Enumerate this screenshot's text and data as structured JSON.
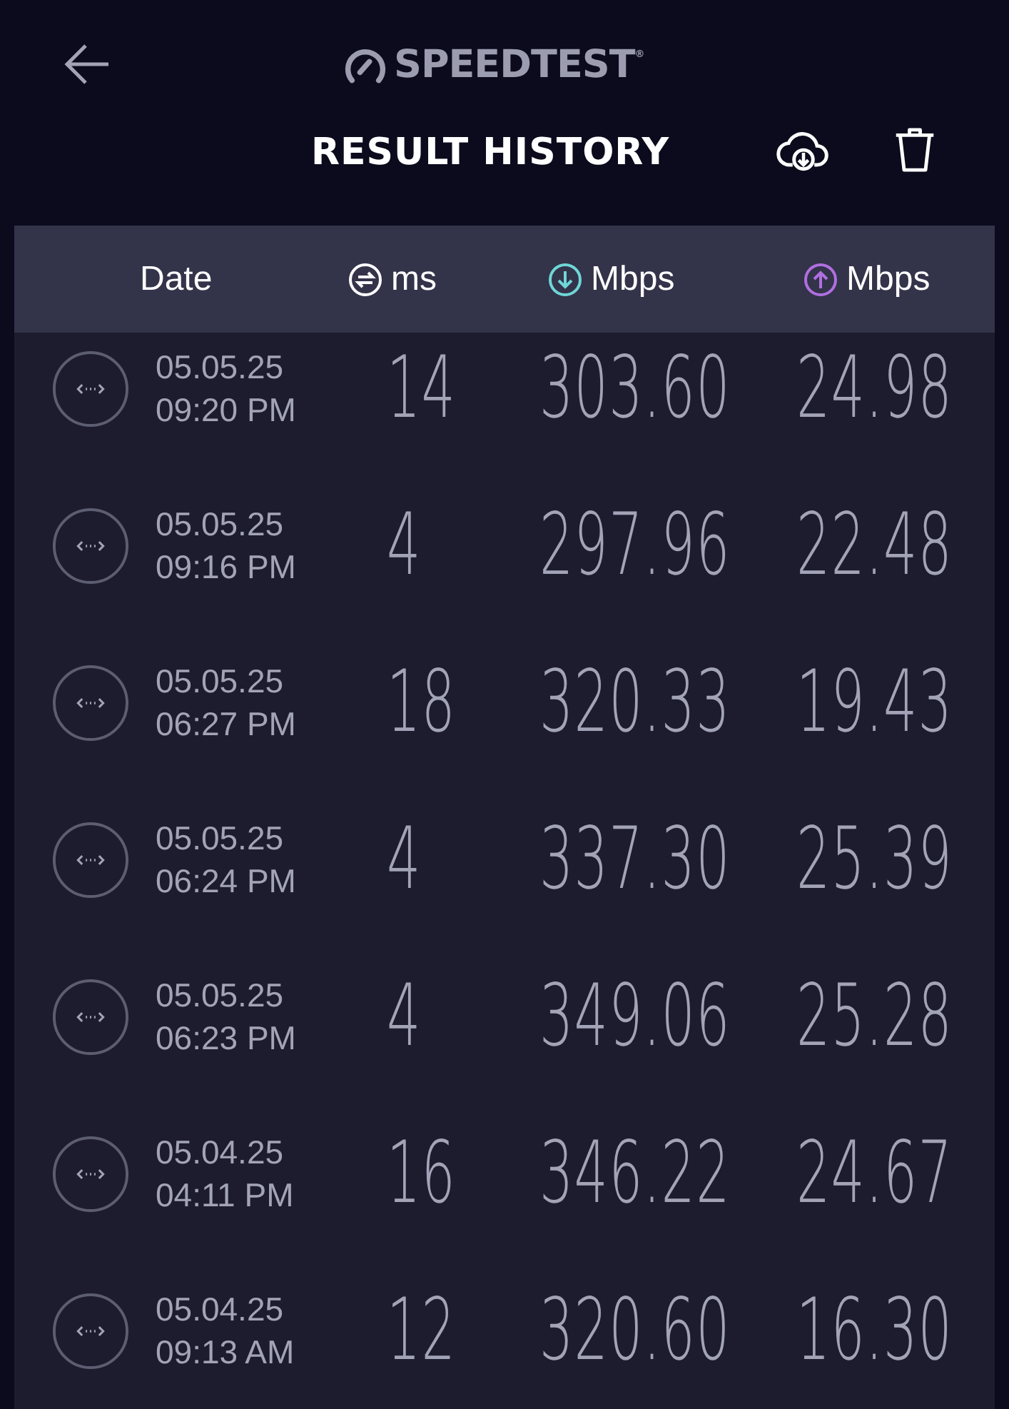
{
  "logo": {
    "text": "SPEEDTEST",
    "mark": "®"
  },
  "title": "RESULT HISTORY",
  "columns": [
    {
      "label": "Date",
      "kind": "date"
    },
    {
      "label": "ms",
      "kind": "ping"
    },
    {
      "label": "Mbps",
      "kind": "download"
    },
    {
      "label": "Mbps",
      "kind": "upload"
    }
  ],
  "rows": [
    {
      "date": "05.05.25",
      "time": "09:20 PM",
      "ping": "14",
      "download": "303.60",
      "upload": "24.98"
    },
    {
      "date": "05.05.25",
      "time": "09:16 PM",
      "ping": "4",
      "download": "297.96",
      "upload": "22.48"
    },
    {
      "date": "05.05.25",
      "time": "06:27 PM",
      "ping": "18",
      "download": "320.33",
      "upload": "19.43"
    },
    {
      "date": "05.05.25",
      "time": "06:24 PM",
      "ping": "4",
      "download": "337.30",
      "upload": "25.39"
    },
    {
      "date": "05.05.25",
      "time": "06:23 PM",
      "ping": "4",
      "download": "349.06",
      "upload": "25.28"
    },
    {
      "date": "05.04.25",
      "time": "04:11 PM",
      "ping": "16",
      "download": "346.22",
      "upload": "24.67"
    },
    {
      "date": "05.04.25",
      "time": "09:13 AM",
      "ping": "12",
      "download": "320.60",
      "upload": "16.30"
    }
  ]
}
